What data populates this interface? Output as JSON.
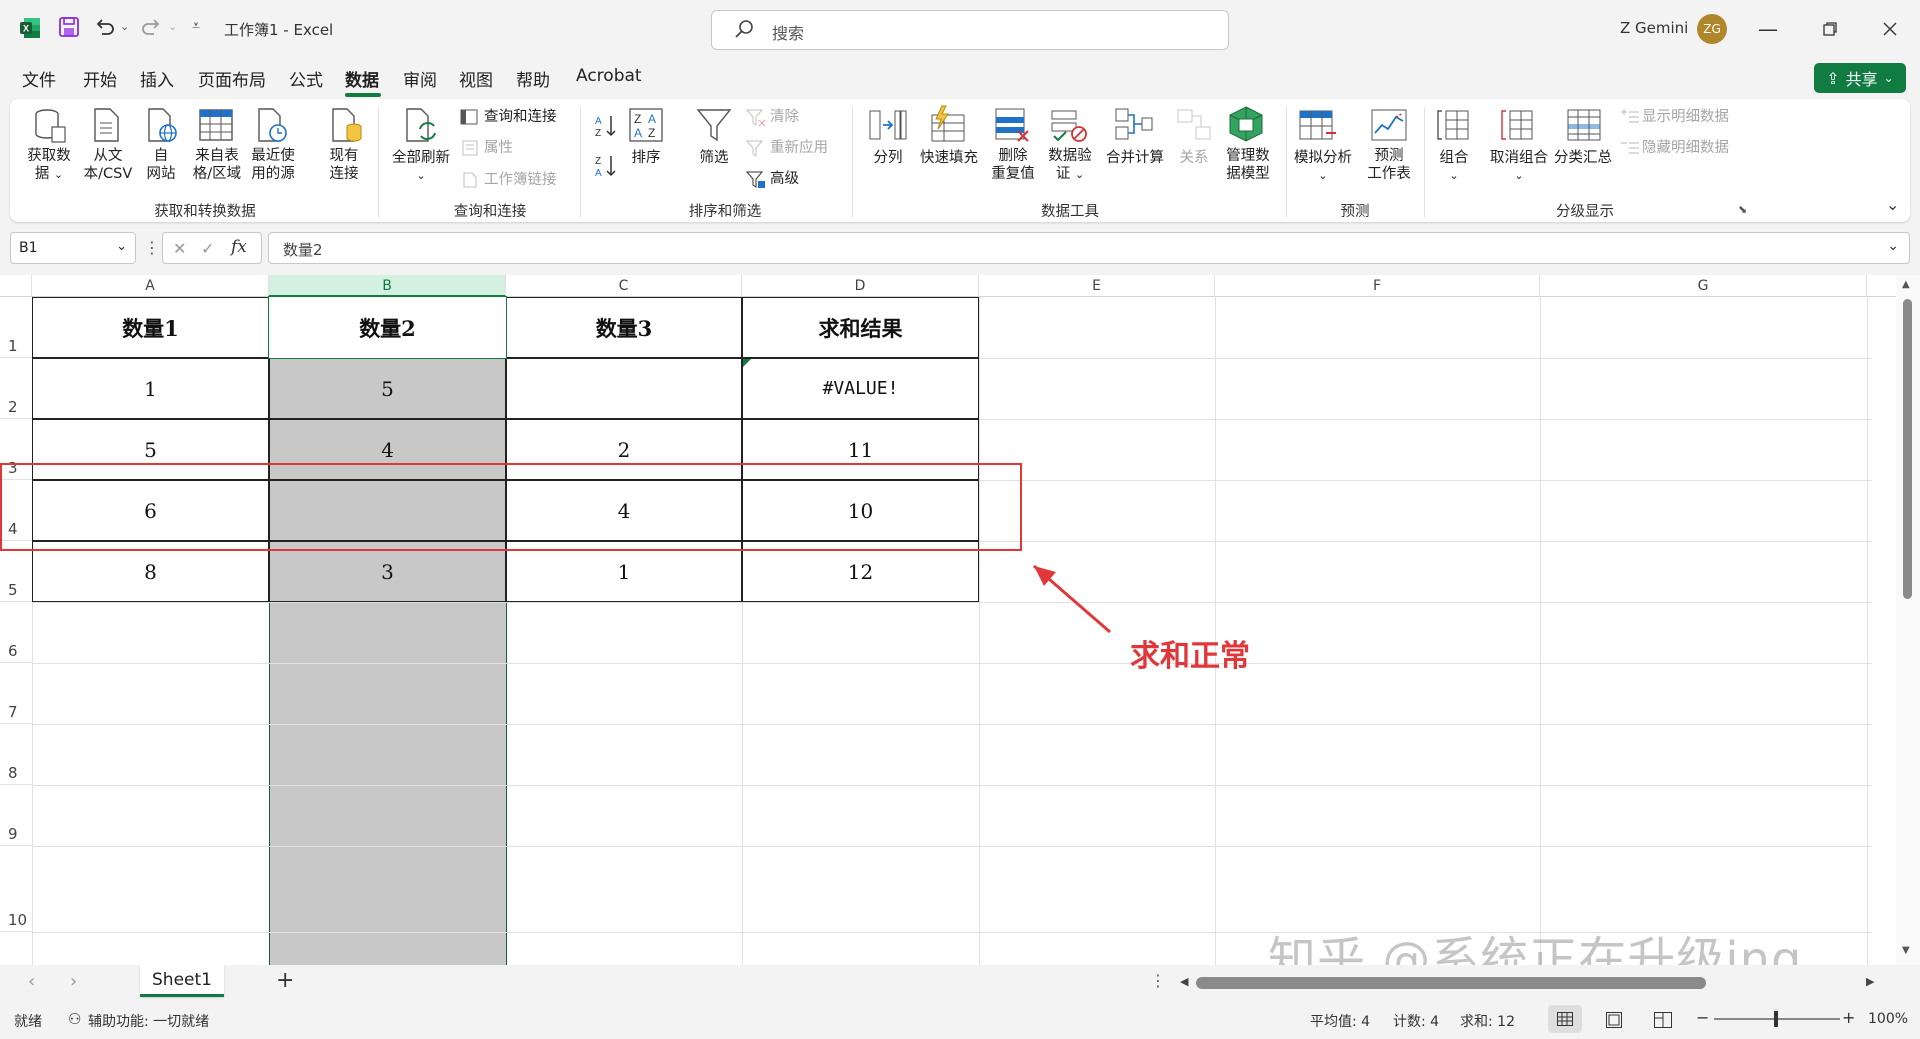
{
  "window": {
    "app_title": "工作簿1 - Excel",
    "search_placeholder": "搜索",
    "user_name": "Z Gemini",
    "user_initials": "ZG"
  },
  "menu": {
    "tabs": [
      "文件",
      "开始",
      "插入",
      "页面布局",
      "公式",
      "数据",
      "审阅",
      "视图",
      "帮助",
      "Acrobat"
    ],
    "active": "数据",
    "share_label": "共享"
  },
  "ribbon": {
    "get_data": {
      "get_data_l1": "获取数",
      "get_data_l2": "据",
      "from_text_l1": "从文",
      "from_text_l2": "本/CSV",
      "from_web_l1": "自",
      "from_web_l2": "网站",
      "from_table_l1": "来自表",
      "from_table_l2": "格/区域",
      "recent_l1": "最近使",
      "recent_l2": "用的源",
      "existing_l1": "现有",
      "existing_l2": "连接",
      "group_label": "获取和转换数据"
    },
    "queries": {
      "refresh_all": "全部刷新",
      "queries_connections": "查询和连接",
      "properties": "属性",
      "workbook_links": "工作簿链接",
      "group_label": "查询和连接"
    },
    "sort_filter": {
      "sort": "排序",
      "filter": "筛选",
      "clear": "清除",
      "reapply": "重新应用",
      "advanced": "高级",
      "group_label": "排序和筛选"
    },
    "data_tools": {
      "text_to_columns": "分列",
      "flash_fill": "快速填充",
      "remove_dup_l1": "删除",
      "remove_dup_l2": "重复值",
      "validation_l1": "数据验",
      "validation_l2": "证",
      "consolidate": "合并计算",
      "relationships": "关系",
      "data_model_l1": "管理数",
      "data_model_l2": "据模型",
      "group_label": "数据工具"
    },
    "forecast": {
      "what_if": "模拟分析",
      "forecast_sheet_l1": "预测",
      "forecast_sheet_l2": "工作表",
      "group_label": "预测"
    },
    "outline": {
      "group": "组合",
      "ungroup": "取消组合",
      "subtotal": "分类汇总",
      "show_detail": "显示明细数据",
      "hide_detail": "隐藏明细数据",
      "group_label": "分级显示"
    }
  },
  "formula_bar": {
    "name_box": "B1",
    "formula": "数量2"
  },
  "sheet": {
    "columns": [
      "A",
      "B",
      "C",
      "D",
      "E",
      "F",
      "G"
    ],
    "rows": [
      "1",
      "2",
      "3",
      "4",
      "5",
      "6",
      "7",
      "8",
      "9",
      "10"
    ],
    "cells": {
      "A1": "数量1",
      "B1": "数量2",
      "C1": "数量3",
      "D1": "求和结果",
      "A2": "1",
      "B2": "5",
      "C2": "",
      "D2": "#VALUE!",
      "A3": "5",
      "B3": "4",
      "C3": "2",
      "D3": "11",
      "A4": "6",
      "B4": "",
      "C4": "4",
      "D4": "10",
      "A5": "8",
      "B5": "3",
      "C5": "1",
      "D5": "12"
    },
    "annotation": "求和正常",
    "annotation_color": "#e0383a",
    "watermark": "知乎 @系统正在升级ing"
  },
  "tabs_bar": {
    "sheet_name": "Sheet1"
  },
  "status": {
    "ready": "就绪",
    "accessibility": "辅助功能: 一切就绪",
    "average": "平均值: 4",
    "count": "计数: 4",
    "sum": "求和: 12",
    "zoom": "100%"
  },
  "colors": {
    "accent": "#107c41",
    "selected_column_fill": "#c8c8c8",
    "highlight_box": "#e0383a"
  }
}
